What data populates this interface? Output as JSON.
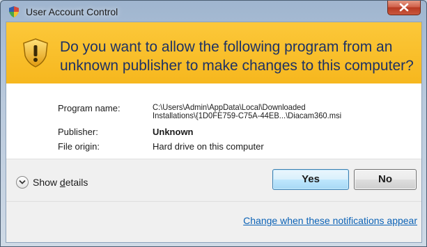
{
  "window": {
    "title": "User Account Control",
    "close_icon": "close-icon",
    "title_icon": "uac-shield-icon"
  },
  "banner": {
    "question": "Do you want to allow the following program from an unknown publisher to make changes to this computer?",
    "icon": "warning-shield-icon"
  },
  "details": {
    "program_name_label": "Program name:",
    "program_name_line1": "C:\\Users\\Admin\\AppData\\Local\\Downloaded",
    "program_name_line2": "Installations\\{1D0FE759-C75A-44EB...\\Diacam360.msi",
    "publisher_label": "Publisher:",
    "publisher_value": "Unknown",
    "origin_label": "File origin:",
    "origin_value": "Hard drive on this computer"
  },
  "footer": {
    "show_details_prefix": "Show ",
    "show_details_accel": "d",
    "show_details_suffix": "etails",
    "yes_label": "Yes",
    "no_label": "No",
    "link_text": "Change when these notifications appear"
  },
  "colors": {
    "banner": "#fbc02d",
    "question_text": "#1e3264",
    "link": "#0b62b6",
    "yes_border": "#3c7fb1"
  }
}
